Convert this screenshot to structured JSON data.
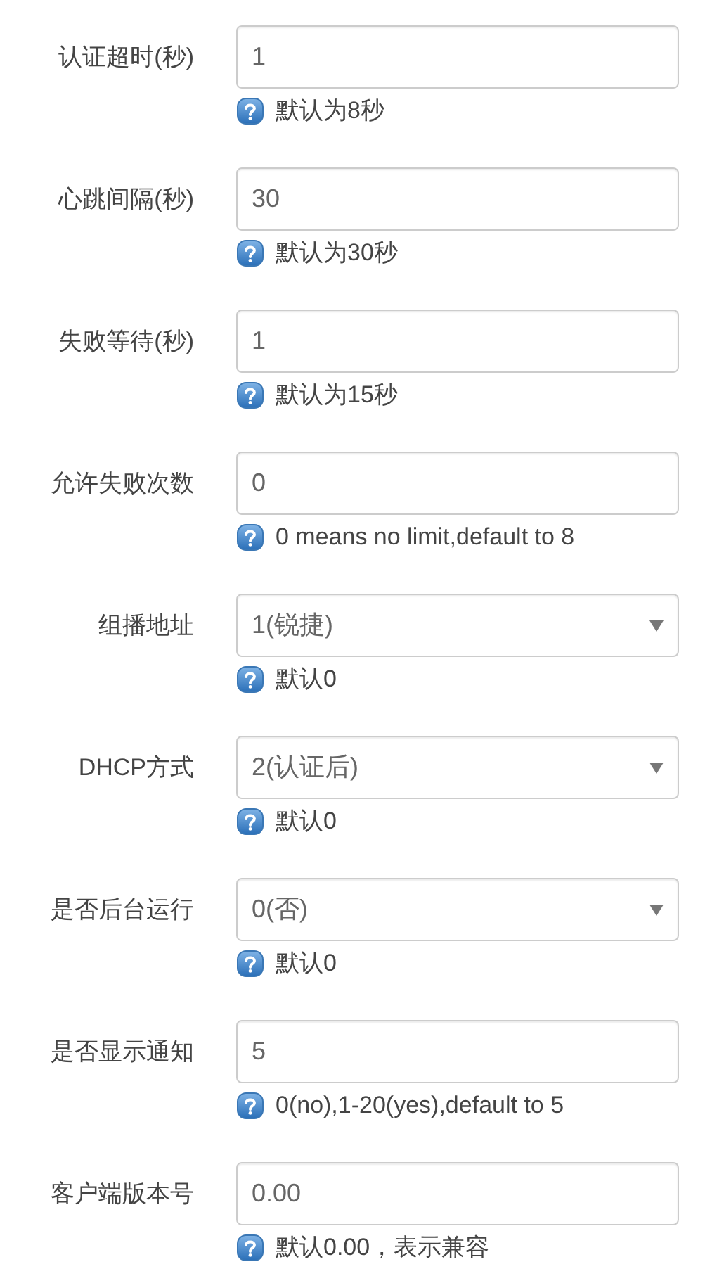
{
  "fields": [
    {
      "label": "认证超时(秒)",
      "kind": "text",
      "value": "1",
      "hint": "默认为8秒"
    },
    {
      "label": "心跳间隔(秒)",
      "kind": "text",
      "value": "30",
      "hint": "默认为30秒"
    },
    {
      "label": "失败等待(秒)",
      "kind": "text",
      "value": "1",
      "hint": "默认为15秒"
    },
    {
      "label": "允许失败次数",
      "kind": "text",
      "value": "0",
      "hint": "0 means no limit,default to 8"
    },
    {
      "label": "组播地址",
      "kind": "select",
      "value": "1(锐捷)",
      "hint": "默认0"
    },
    {
      "label": "DHCP方式",
      "kind": "select",
      "value": "2(认证后)",
      "hint": "默认0"
    },
    {
      "label": "是否后台运行",
      "kind": "select",
      "value": "0(否)",
      "hint": "默认0"
    },
    {
      "label": "是否显示通知",
      "kind": "text",
      "value": "5",
      "hint": "0(no),1-20(yes),default to 5"
    },
    {
      "label": "客户端版本号",
      "kind": "text",
      "value": "0.00",
      "hint": "默认0.00，表示兼容"
    }
  ]
}
